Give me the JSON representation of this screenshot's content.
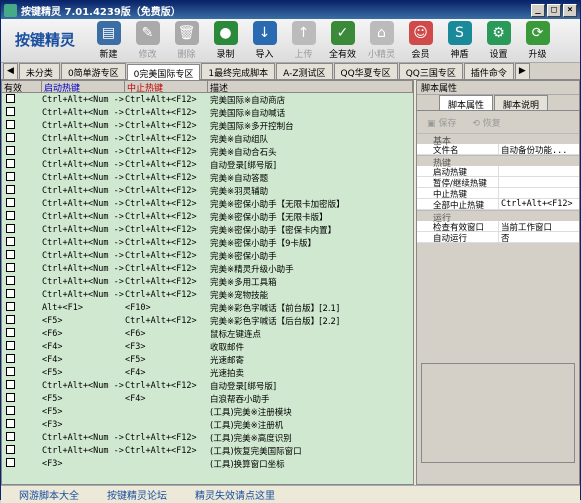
{
  "window": {
    "title": "按键精灵 7.01.4239版（免费版）",
    "btn_min": "_",
    "btn_max": "□",
    "btn_close": "×"
  },
  "logo": "按键精灵",
  "toolbar": [
    {
      "label": "新建",
      "icon": "new-doc-icon",
      "color": "#3a6ea5",
      "glyph": "▤",
      "disabled": false
    },
    {
      "label": "修改",
      "icon": "edit-icon",
      "color": "#aaaaaa",
      "glyph": "✎",
      "disabled": true
    },
    {
      "label": "删除",
      "icon": "trash-icon",
      "color": "#aaaaaa",
      "glyph": "🗑",
      "disabled": true
    },
    {
      "label": "录制",
      "icon": "record-icon",
      "color": "#2a8a3a",
      "glyph": "●",
      "disabled": false
    },
    {
      "label": "导入",
      "icon": "import-icon",
      "color": "#2a6ab0",
      "glyph": "↓",
      "disabled": false
    },
    {
      "label": "上传",
      "icon": "upload-icon",
      "color": "#bbbbbb",
      "glyph": "↑",
      "disabled": true
    },
    {
      "label": "全有效",
      "icon": "check-all-icon",
      "color": "#3a8a3a",
      "glyph": "✓",
      "disabled": false
    },
    {
      "label": "小精灵",
      "icon": "sprite-icon",
      "color": "#bbbbbb",
      "glyph": "⌂",
      "disabled": true
    },
    {
      "label": "会员",
      "icon": "member-icon",
      "color": "#d04a4a",
      "glyph": "☺",
      "disabled": false
    },
    {
      "label": "神盾",
      "icon": "shield-icon",
      "color": "#1a8a9a",
      "glyph": "S",
      "disabled": false
    },
    {
      "label": "设置",
      "icon": "gear-icon",
      "color": "#2a9a5a",
      "glyph": "⚙",
      "disabled": false
    },
    {
      "label": "升级",
      "icon": "upgrade-icon",
      "color": "#3a9a3a",
      "glyph": "⟳",
      "disabled": false
    }
  ],
  "tabs": [
    "未分类",
    "0简单游专区",
    "0完美国际专区",
    "1最终完成脚本",
    "A-Z测试区",
    "QQ华夏专区",
    "QQ三国专区",
    "插件命令"
  ],
  "active_tab": 2,
  "table": {
    "headers": {
      "valid": "有效",
      "start": "启动热键",
      "stop": "中止热键",
      "desc": "描述"
    },
    "rows": [
      {
        "start": "Ctrl+Alt+<Num ->",
        "stop": "Ctrl+Alt+<F12>",
        "desc": "完美国际※自动商店"
      },
      {
        "start": "Ctrl+Alt+<Num ->",
        "stop": "Ctrl+Alt+<F12>",
        "desc": "完美国际※自动喊话"
      },
      {
        "start": "Ctrl+Alt+<Num ->",
        "stop": "Ctrl+Alt+<F12>",
        "desc": "完美国际※多开控制台"
      },
      {
        "start": "Ctrl+Alt+<Num ->",
        "stop": "Ctrl+Alt+<F12>",
        "desc": "完美※自动组队"
      },
      {
        "start": "Ctrl+Alt+<Num ->",
        "stop": "Ctrl+Alt+<F12>",
        "desc": "完美※自动合石头"
      },
      {
        "start": "Ctrl+Alt+<Num ->",
        "stop": "Ctrl+Alt+<F12>",
        "desc": "自动登录[绑号版]"
      },
      {
        "start": "Ctrl+Alt+<Num ->",
        "stop": "Ctrl+Alt+<F12>",
        "desc": "完美※自动答题"
      },
      {
        "start": "Ctrl+Alt+<Num ->",
        "stop": "Ctrl+Alt+<F12>",
        "desc": "完美※羽灵辅助"
      },
      {
        "start": "Ctrl+Alt+<Num ->",
        "stop": "Ctrl+Alt+<F12>",
        "desc": "完美※密保小助手【无限卡加密版】"
      },
      {
        "start": "Ctrl+Alt+<Num ->",
        "stop": "Ctrl+Alt+<F12>",
        "desc": "完美※密保小助手【无限卡版】"
      },
      {
        "start": "Ctrl+Alt+<Num ->",
        "stop": "Ctrl+Alt+<F12>",
        "desc": "完美※密保小助手【密保卡内置】"
      },
      {
        "start": "Ctrl+Alt+<Num ->",
        "stop": "Ctrl+Alt+<F12>",
        "desc": "完美※密保小助手【9卡版】"
      },
      {
        "start": "Ctrl+Alt+<Num ->",
        "stop": "Ctrl+Alt+<F12>",
        "desc": "完美※密保小助手"
      },
      {
        "start": "Ctrl+Alt+<Num ->",
        "stop": "Ctrl+Alt+<F12>",
        "desc": "完美※精灵升级小助手"
      },
      {
        "start": "Ctrl+Alt+<Num ->",
        "stop": "Ctrl+Alt+<F12>",
        "desc": "完美※多用工具箱"
      },
      {
        "start": "Ctrl+Alt+<Num ->",
        "stop": "Ctrl+Alt+<F12>",
        "desc": "完美※宠物技能"
      },
      {
        "start": "Alt+<F1>",
        "stop": "<F10>",
        "desc": "完美※彩色字喊话【前台版】[2.1]"
      },
      {
        "start": "<F5>",
        "stop": "Ctrl+Alt+<F12>",
        "desc": "完美※彩色字喊话【后台版】[2.2]"
      },
      {
        "start": "<F6>",
        "stop": "<F6>",
        "desc": "鼠标左键连点"
      },
      {
        "start": "<F4>",
        "stop": "<F3>",
        "desc": "收取邮件"
      },
      {
        "start": "<F4>",
        "stop": "<F5>",
        "desc": "光速邮寄"
      },
      {
        "start": "<F5>",
        "stop": "<F4>",
        "desc": "光速拍卖"
      },
      {
        "start": "Ctrl+Alt+<Num ->",
        "stop": "Ctrl+Alt+<F12>",
        "desc": "自动登录[绑号版]"
      },
      {
        "start": "<F5>",
        "stop": "<F4>",
        "desc": "白浪帮吞小助手"
      },
      {
        "start": "<F5>",
        "stop": "",
        "desc": "(工具)完美※注册模块"
      },
      {
        "start": "<F3>",
        "stop": "",
        "desc": "(工具)完美※注册机"
      },
      {
        "start": "Ctrl+Alt+<Num ->",
        "stop": "Ctrl+Alt+<F12>",
        "desc": "(工具)完美※高度识别"
      },
      {
        "start": "Ctrl+Alt+<Num ->",
        "stop": "Ctrl+Alt+<F12>",
        "desc": "(工具)恢复完美国际窗口"
      },
      {
        "start": "<F3>",
        "stop": "",
        "desc": "(工具)换算窗口坐标"
      }
    ]
  },
  "props": {
    "title": "脚本属性",
    "tabs": [
      "脚本属性",
      "脚本说明"
    ],
    "save": "保存",
    "restore": "恢复",
    "sections": [
      {
        "name": "基本",
        "rows": [
          {
            "k": "文件名",
            "v": "自动备份功能..."
          }
        ]
      },
      {
        "name": "热键",
        "rows": [
          {
            "k": "启动热键",
            "v": ""
          },
          {
            "k": "暂停/继续热键",
            "v": ""
          },
          {
            "k": "中止热键",
            "v": ""
          },
          {
            "k": "全部中止热键",
            "v": "Ctrl+Alt+<F12>"
          }
        ]
      },
      {
        "name": "运行",
        "rows": [
          {
            "k": "检查有效窗口",
            "v": "当前工作窗口"
          },
          {
            "k": "自动运行",
            "v": "否"
          }
        ]
      }
    ]
  },
  "status": {
    "link1": "网游脚本大全",
    "link2": "按键精灵论坛",
    "link3": "精灵失效请点这里"
  }
}
